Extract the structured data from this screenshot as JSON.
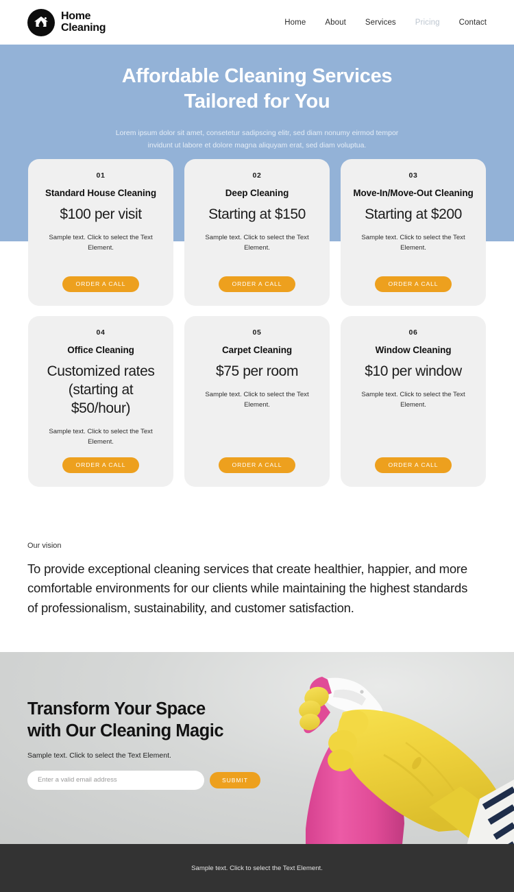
{
  "header": {
    "brand": {
      "line1": "Home",
      "line2": "Cleaning",
      "logo_icon": "house-droplet-icon"
    },
    "nav": [
      {
        "label": "Home",
        "active": false
      },
      {
        "label": "About",
        "active": false
      },
      {
        "label": "Services",
        "active": false
      },
      {
        "label": "Pricing",
        "active": true
      },
      {
        "label": "Contact",
        "active": false
      }
    ]
  },
  "hero": {
    "title_line1": "Affordable Cleaning Services",
    "title_line2": "Tailored for You",
    "subtitle": "Lorem ipsum dolor sit amet, consetetur sadipscing elitr, sed diam nonumy eirmod tempor invidunt ut labore et dolore magna aliquyam erat, sed diam voluptua.",
    "background_color": "#93b2d7"
  },
  "pricing": {
    "button_label": "ORDER A CALL",
    "sample_text": "Sample text. Click to select the Text Element.",
    "cards": [
      {
        "number": "01",
        "title": "Standard House Cleaning",
        "price": "$100 per visit",
        "desc": "Sample text. Click to select the Text Element.",
        "cta": "ORDER A CALL"
      },
      {
        "number": "02",
        "title": "Deep Cleaning",
        "price": "Starting at $150",
        "desc": "Sample text. Click to select the Text Element.",
        "cta": "ORDER A CALL"
      },
      {
        "number": "03",
        "title": "Move-In/Move-Out Cleaning",
        "price": "Starting at $200",
        "desc": "Sample text. Click to select the Text Element.",
        "cta": "ORDER A CALL"
      },
      {
        "number": "04",
        "title": "Office Cleaning",
        "price": "Customized rates (starting at $50/hour)",
        "desc": "Sample text. Click to select the Text Element.",
        "cta": "ORDER A CALL"
      },
      {
        "number": "05",
        "title": "Carpet Cleaning",
        "price": "$75 per room",
        "desc": "Sample text. Click to select the Text Element.",
        "cta": "ORDER A CALL"
      },
      {
        "number": "06",
        "title": "Window Cleaning",
        "price": "$10 per window",
        "desc": "Sample text. Click to select the Text Element.",
        "cta": "ORDER A CALL"
      }
    ]
  },
  "vision": {
    "label": "Our vision",
    "body": "To provide exceptional cleaning services that create healthier, happier, and more comfortable environments for our clients while maintaining the highest standards of professionalism, sustainability, and customer satisfaction."
  },
  "cta": {
    "title_line1": "Transform Your Space",
    "title_line2": "with Our Cleaning Magic",
    "subtitle": "Sample text. Click to select the Text Element.",
    "email_placeholder": "Enter a valid email address",
    "email_value": "",
    "submit_label": "SUBMIT",
    "photo_description": "hand-in-yellow-glove-holding-pink-spray-bottle"
  },
  "footer": {
    "text": "Sample text. Click to select the Text Element.",
    "background_color": "#333333"
  },
  "colors": {
    "accent_orange": "#eda01e",
    "hero_blue": "#93b2d7",
    "card_gray": "#f0f0f0",
    "footer_dark": "#333333"
  }
}
